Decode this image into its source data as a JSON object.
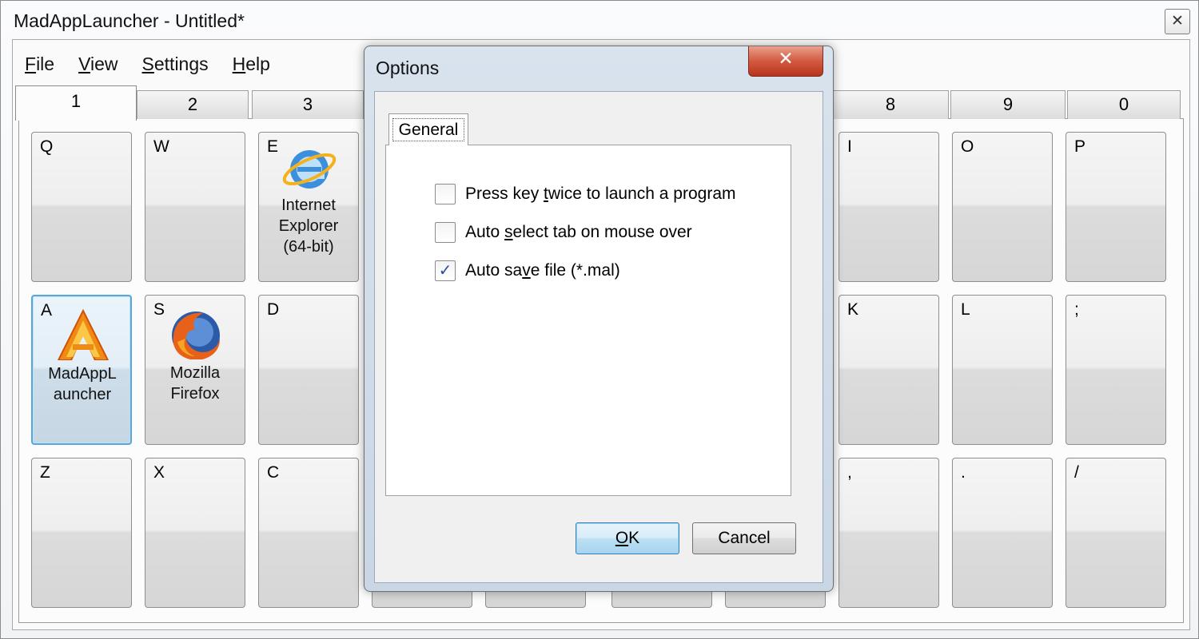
{
  "window": {
    "title": "MadAppLauncher - Untitled*",
    "close_glyph": "✕"
  },
  "menu": [
    {
      "label": "File",
      "accel": "F",
      "rest": "ile"
    },
    {
      "label": "View",
      "accel": "V",
      "rest": "iew"
    },
    {
      "label": "Settings",
      "accel": "S",
      "rest": "ettings"
    },
    {
      "label": "Help",
      "accel": "H",
      "rest": "elp"
    }
  ],
  "tabs": [
    {
      "label": "1",
      "active": true
    },
    {
      "label": "2"
    },
    {
      "label": "3"
    },
    {
      "label": "8"
    },
    {
      "label": "9"
    },
    {
      "label": "0"
    }
  ],
  "keys": {
    "q": {
      "label": "Q"
    },
    "w": {
      "label": "W"
    },
    "e": {
      "label": "E",
      "name_line1": "Internet",
      "name_line2": "Explorer",
      "name_line3": "(64-bit)",
      "icon": "internet-explorer-icon"
    },
    "i": {
      "label": "I"
    },
    "o": {
      "label": "O"
    },
    "p": {
      "label": "P"
    },
    "a": {
      "label": "A",
      "name_line1": "MadAppL",
      "name_line2": "auncher",
      "icon": "madapplauncher-icon"
    },
    "s": {
      "label": "S",
      "name_line1": "Mozilla",
      "name_line2": "Firefox",
      "icon": "firefox-icon"
    },
    "d": {
      "label": "D"
    },
    "k": {
      "label": "K"
    },
    "l": {
      "label": "L"
    },
    "semicolon": {
      "label": ";"
    },
    "z": {
      "label": "Z"
    },
    "x": {
      "label": "X"
    },
    "c": {
      "label": "C"
    },
    "comma": {
      "label": ","
    },
    "period": {
      "label": "."
    },
    "slash": {
      "label": "/"
    }
  },
  "dialog": {
    "title": "Options",
    "close_glyph": "✕",
    "tab_label": "General",
    "options": [
      {
        "pre": "Press key ",
        "accel": "t",
        "post": "wice to launch a program",
        "checked": false
      },
      {
        "pre": "Auto ",
        "accel": "s",
        "post": "elect tab on mouse over",
        "checked": false
      },
      {
        "pre": "Auto sa",
        "accel": "v",
        "post": "e file (*.mal)",
        "checked": true
      }
    ],
    "check_glyph": "✓",
    "ok": {
      "accel": "O",
      "rest": "K"
    },
    "cancel_label": "Cancel"
  },
  "colors": {
    "focus_border": "#5aa6d8",
    "dialog_close": "#c8452b",
    "check": "#2a4f9e"
  }
}
